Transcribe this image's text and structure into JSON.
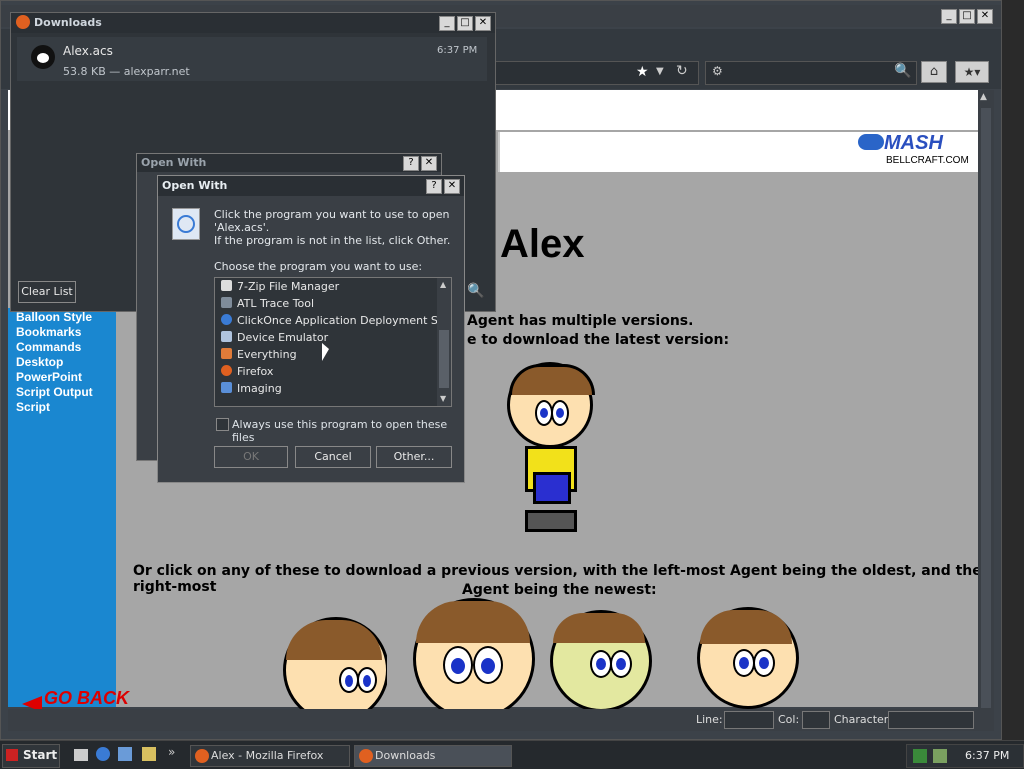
{
  "firefox": {
    "window_title": "Alex - Mozilla Firefox",
    "mash_brand": "MASH",
    "mash_site": "BELLCRAFT.COM"
  },
  "page": {
    "title": "Alex",
    "line1": "Agent has multiple versions.",
    "line2": "e to download the latest version:",
    "previous_text_1": "Or click on any of these to download a previous version, with the left-most Agent being the oldest, and the right-most",
    "previous_text_2": "Agent being the newest:",
    "go_back": "GO BACK"
  },
  "sidebar": {
    "items": [
      {
        "label": "Balloon Style"
      },
      {
        "label": "Bookmarks"
      },
      {
        "label": "Commands"
      },
      {
        "label": "Desktop"
      },
      {
        "label": "PowerPoint"
      },
      {
        "label": "Script Output"
      },
      {
        "label": "Script"
      }
    ]
  },
  "statusbar": {
    "line_label": "Line:",
    "col_label": "Col:",
    "character_label": "Character:"
  },
  "downloads": {
    "title": "Downloads",
    "item_name": "Alex.acs",
    "item_meta": "53.8 KB — alexparr.net",
    "item_time": "6:37 PM",
    "clear_list": "Clear List"
  },
  "open_with_back": {
    "title": "Open With"
  },
  "open_with": {
    "title": "Open With",
    "instruction_1": "Click the program you want to use to open",
    "instruction_2": "'Alex.acs'.",
    "instruction_3": "If the program is not in the list, click Other.",
    "choose_label": "Choose the program you want to use:",
    "programs": [
      {
        "label": "7-Zip File Manager",
        "color": "#dddddd"
      },
      {
        "label": "ATL Trace Tool",
        "color": "#7f8c9a"
      },
      {
        "label": "ClickOnce Application Deployment Su...",
        "color": "#3a7bd5"
      },
      {
        "label": "Device Emulator",
        "color": "#b0c4de"
      },
      {
        "label": "Everything",
        "color": "#e07b39"
      },
      {
        "label": "Firefox",
        "color": "#e06020"
      },
      {
        "label": "Imaging",
        "color": "#5a8fd8"
      }
    ],
    "always_use": "Always use this program to open these files",
    "ok": "OK",
    "cancel": "Cancel",
    "other": "Other..."
  },
  "taskbar": {
    "start": "Start",
    "firefox_task": "Alex - Mozilla Firefox",
    "downloads_task": "Downloads",
    "clock": "6:37 PM"
  }
}
